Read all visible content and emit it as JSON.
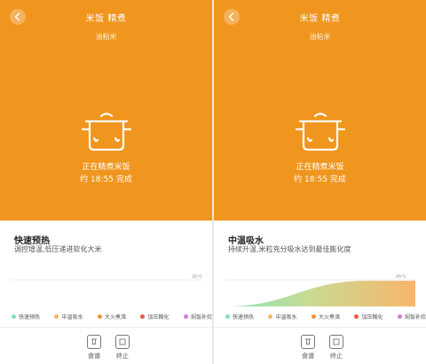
{
  "colors": {
    "accent": "#F0951E",
    "legend": [
      "#84E3B8",
      "#F8B56A",
      "#F39434",
      "#EA5A3C",
      "#D87AD0"
    ]
  },
  "icons": {
    "back": "chevron-left-icon",
    "cooker": "rice-cooker-icon",
    "recipe": "recipe-book-icon",
    "stop": "stop-icon"
  },
  "panels": [
    {
      "header": {
        "title": "米饭 精煮",
        "subtitle": "油粘米"
      },
      "status": {
        "text": "正在精煮米饭",
        "eta": "约  18:55 完成"
      },
      "stage": {
        "title": "快速预热",
        "description": "调控增温,低压递进软化大米"
      },
      "chart": {
        "temp_label": "30℃",
        "progress": 0.0
      },
      "legend": [
        "快速预热",
        "中温吸水",
        "大火煮沸",
        "加压糊化",
        "焖饭补炊"
      ],
      "actions": {
        "recipe": "食谱",
        "stop": "终止"
      }
    },
    {
      "header": {
        "title": "米饭 精煮",
        "subtitle": "油粘米"
      },
      "status": {
        "text": "正在精煮米饭",
        "eta": "约  18:55 完成"
      },
      "stage": {
        "title": "中温吸水",
        "description": "持续升温,米粒充分吸水达到最佳膨化度"
      },
      "chart": {
        "temp_label": "45℃",
        "progress": 1.0
      },
      "legend": [
        "快速预热",
        "中温吸水",
        "大火煮沸",
        "加压糊化",
        "焖饭补炊"
      ],
      "actions": {
        "recipe": "食谱",
        "stop": "终止"
      }
    }
  ]
}
